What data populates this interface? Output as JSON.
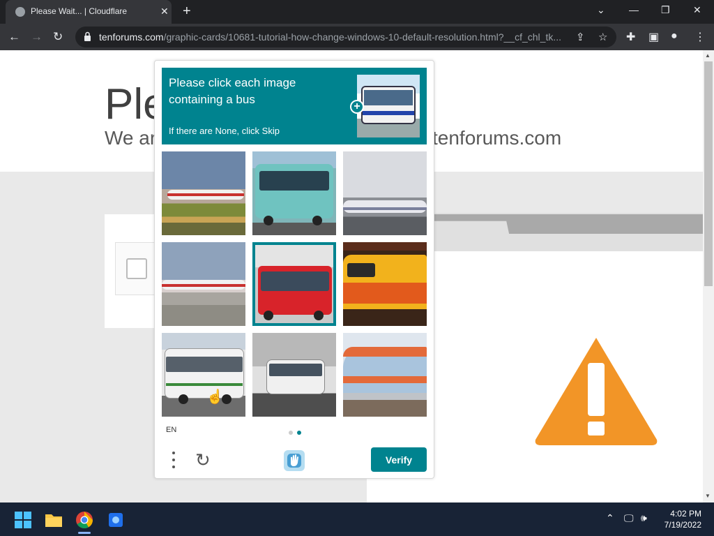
{
  "browser": {
    "tab_title": "Please Wait... | Cloudflare",
    "tab_close": "✕",
    "new_tab": "+",
    "url_host": "tenforums.com",
    "url_path": "/graphic-cards/10681-tutorial-how-change-windows-10-default-resolution.html?__cf_chl_tk...",
    "window_controls": {
      "dropdown": "⌄",
      "minimize": "—",
      "restore": "❐",
      "close": "✕"
    },
    "nav": {
      "back": "←",
      "forward": "→",
      "reload": "↻"
    }
  },
  "page": {
    "heading_partial": "Ple",
    "subheading_partial": "We ar",
    "site_partial": "tenforums.com"
  },
  "captcha": {
    "prompt": "Please click each image containing a bus",
    "sub": "If there are None, click Skip",
    "plus": "+",
    "language": "EN",
    "verify_label": "Verify",
    "refresh": "↻",
    "tiles": [
      {
        "subject": "airplane",
        "selected": false
      },
      {
        "subject": "teal bus",
        "selected": false
      },
      {
        "subject": "airplane",
        "selected": false
      },
      {
        "subject": "airplane",
        "selected": false
      },
      {
        "subject": "red bus",
        "selected": true
      },
      {
        "subject": "yellow train",
        "selected": false
      },
      {
        "subject": "white bus",
        "selected": false
      },
      {
        "subject": "city bus",
        "selected": false
      },
      {
        "subject": "train",
        "selected": false
      }
    ],
    "accent": "#00838f"
  },
  "taskbar": {
    "time": "4:02 PM",
    "date": "7/19/2022",
    "apps": [
      "start-icon",
      "file-explorer-icon",
      "chrome-icon",
      "app-icon"
    ]
  }
}
